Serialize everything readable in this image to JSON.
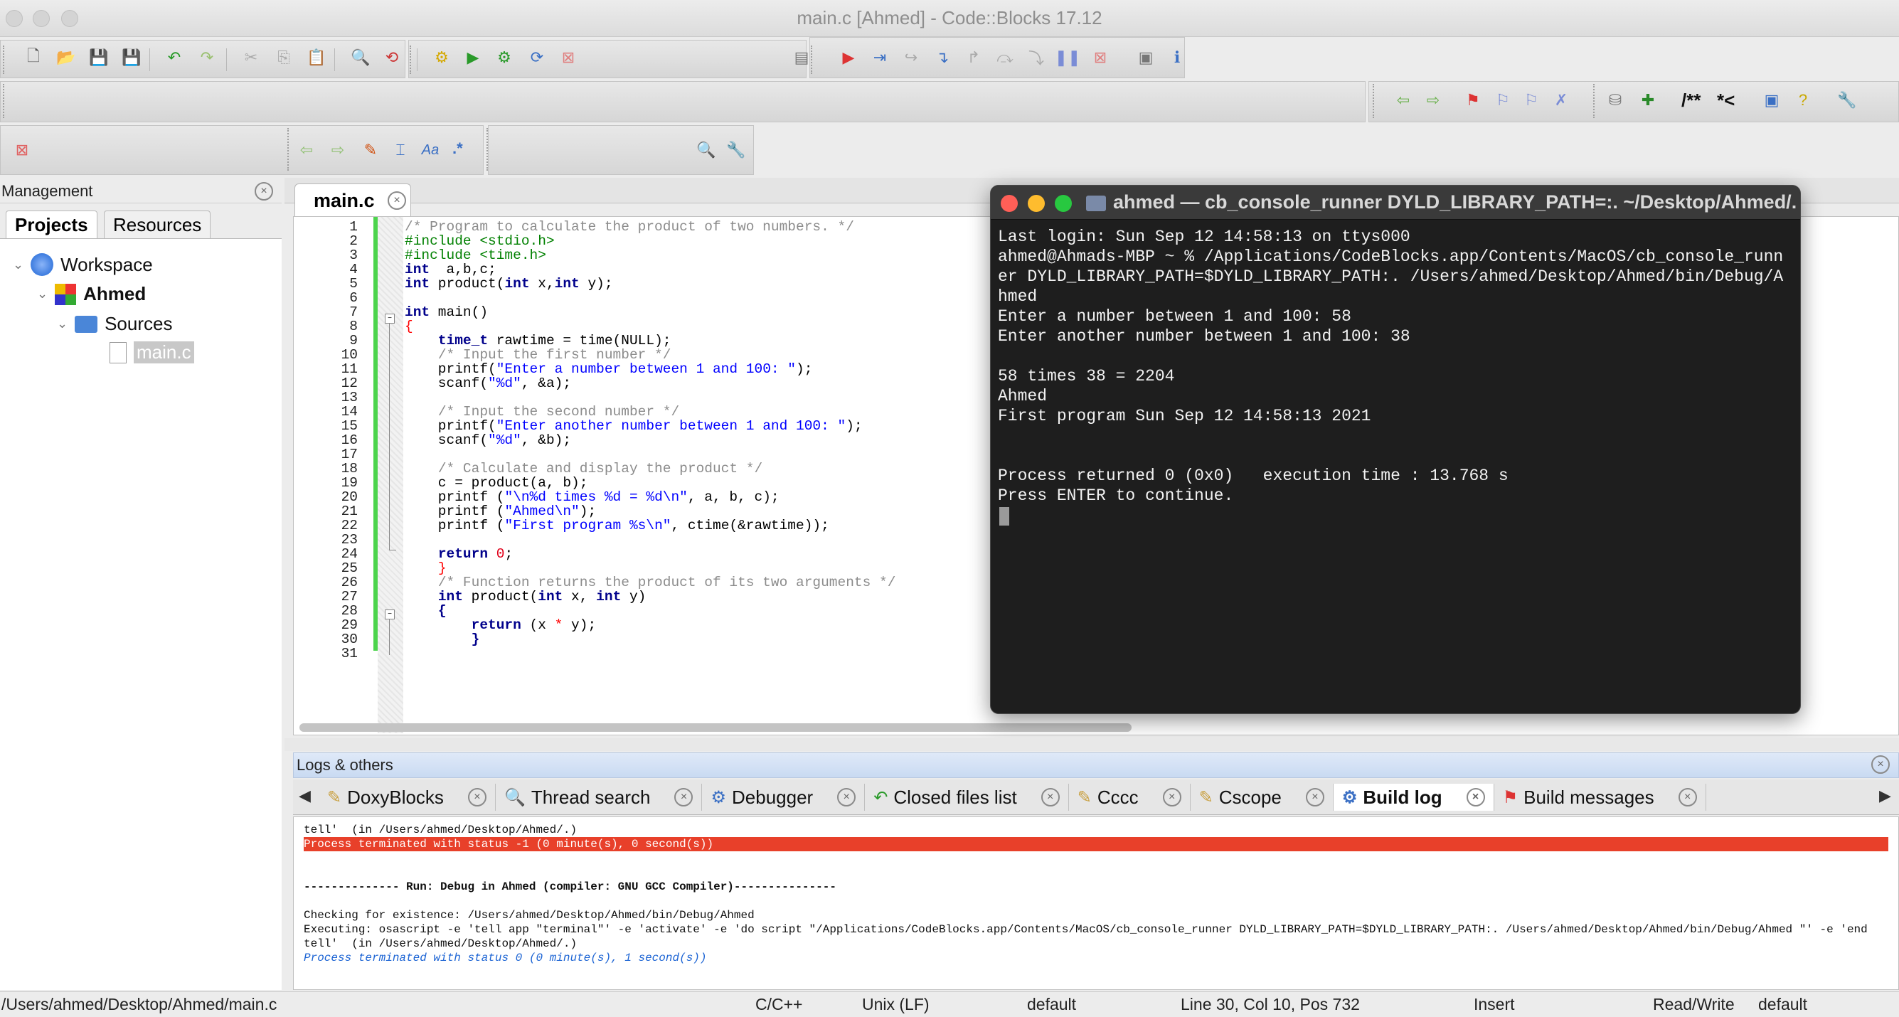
{
  "window": {
    "title": "main.c [Ahmed] - Code::Blocks 17.12"
  },
  "toolbar": {
    "icons": [
      "new-file-icon",
      "open-icon",
      "save-icon",
      "save-all-icon",
      "undo-icon",
      "redo-icon",
      "cut-icon",
      "copy-icon",
      "paste-icon",
      "find-icon",
      "replace-icon",
      "build-icon",
      "run-icon",
      "build-run-icon",
      "rebuild-icon",
      "abort-icon",
      "build-target-icon",
      "debug-icon",
      "run-to-cursor-icon",
      "next-line-icon",
      "step-into-icon",
      "step-out-icon",
      "next-instruction-icon",
      "step-into-instruction-icon",
      "break-debugger-icon",
      "stop-debugger-icon",
      "debug-windows-icon",
      "info-icon"
    ],
    "doc_tokens": {
      "doxy_block": "/**",
      "doxy_line": "*<"
    },
    "regex_label": ".*"
  },
  "management": {
    "title": "Management",
    "tabs": [
      "Projects",
      "Resources"
    ],
    "tree": {
      "workspace": "Workspace",
      "project": "Ahmed",
      "folder": "Sources",
      "file": "main.c"
    }
  },
  "editor": {
    "tab": "main.c",
    "lines": [
      [
        [
          "cm",
          "/* Program to calculate the product of two numbers. */"
        ]
      ],
      [
        [
          "pp",
          "#include <stdio.h>"
        ]
      ],
      [
        [
          "pp",
          "#include <time.h>"
        ]
      ],
      [
        [
          "kw",
          "int"
        ],
        [
          "",
          "  a,b,c;"
        ]
      ],
      [
        [
          "kw",
          "int"
        ],
        [
          "",
          " product("
        ],
        [
          "kw",
          "int"
        ],
        [
          "",
          " x,"
        ],
        [
          "kw",
          "int"
        ],
        [
          "",
          " y);"
        ]
      ],
      [
        [
          "",
          ""
        ]
      ],
      [
        [
          "kw",
          "int"
        ],
        [
          "",
          " main()"
        ]
      ],
      [
        [
          "op",
          "{"
        ]
      ],
      [
        [
          "",
          "    "
        ],
        [
          "kw",
          "time_t"
        ],
        [
          "",
          " rawtime = time(NULL);"
        ]
      ],
      [
        [
          "",
          "    "
        ],
        [
          "cm",
          "/* Input the first number */"
        ]
      ],
      [
        [
          "",
          "    printf("
        ],
        [
          "st",
          "\"Enter a number between 1 and 100: \""
        ],
        [
          "",
          ");"
        ]
      ],
      [
        [
          "",
          "    scanf("
        ],
        [
          "st",
          "\"%d\""
        ],
        [
          "",
          ", &a);"
        ]
      ],
      [
        [
          "",
          ""
        ]
      ],
      [
        [
          "",
          "    "
        ],
        [
          "cm",
          "/* Input the second number */"
        ]
      ],
      [
        [
          "",
          "    printf("
        ],
        [
          "st",
          "\"Enter another number between 1 and 100: \""
        ],
        [
          "",
          ");"
        ]
      ],
      [
        [
          "",
          "    scanf("
        ],
        [
          "st",
          "\"%d\""
        ],
        [
          "",
          ", &b);"
        ]
      ],
      [
        [
          "",
          ""
        ]
      ],
      [
        [
          "",
          "    "
        ],
        [
          "cm",
          "/* Calculate and display the product */"
        ]
      ],
      [
        [
          "",
          "    c = product(a, b);"
        ]
      ],
      [
        [
          "",
          "    printf ("
        ],
        [
          "st",
          "\"\\n%d times %d = %d\\n\""
        ],
        [
          "",
          ", a, b, c);"
        ]
      ],
      [
        [
          "",
          "    printf ("
        ],
        [
          "st",
          "\"Ahmed\\n\""
        ],
        [
          "",
          ");"
        ]
      ],
      [
        [
          "",
          "    printf ("
        ],
        [
          "st",
          "\"First program %s\\n\""
        ],
        [
          "",
          ", ctime(&rawtime));"
        ]
      ],
      [
        [
          "",
          ""
        ]
      ],
      [
        [
          "",
          "    "
        ],
        [
          "kw",
          "return"
        ],
        [
          "",
          " "
        ],
        [
          "nm",
          "0"
        ],
        [
          "",
          ";"
        ]
      ],
      [
        [
          "",
          "    "
        ],
        [
          "op",
          "}"
        ]
      ],
      [
        [
          "",
          "    "
        ],
        [
          "cm",
          "/* Function returns the product of its two arguments */"
        ]
      ],
      [
        [
          "",
          "    "
        ],
        [
          "kw",
          "int"
        ],
        [
          "",
          " product("
        ],
        [
          "kw",
          "int"
        ],
        [
          "",
          " x, "
        ],
        [
          "kw",
          "int"
        ],
        [
          "",
          " y)"
        ]
      ],
      [
        [
          "",
          "    "
        ],
        [
          "kw",
          "{"
        ]
      ],
      [
        [
          "",
          "        "
        ],
        [
          "kw",
          "return"
        ],
        [
          "",
          " (x "
        ],
        [
          "op",
          "*"
        ],
        [
          "",
          " y);"
        ]
      ],
      [
        [
          "",
          "        "
        ],
        [
          "kw",
          "}"
        ]
      ],
      [
        [
          "",
          ""
        ]
      ]
    ]
  },
  "terminal": {
    "title": "ahmed — cb_console_runner DYLD_LIBRARY_PATH=:. ~/Desktop/Ahmed/...",
    "lines": [
      "Last login: Sun Sep 12 14:58:13 on ttys000",
      "ahmed@Ahmads-MBP ~ % /Applications/CodeBlocks.app/Contents/MacOS/cb_console_runn",
      "er DYLD_LIBRARY_PATH=$DYLD_LIBRARY_PATH:. /Users/ahmed/Desktop/Ahmed/bin/Debug/A",
      "hmed",
      "Enter a number between 1 and 100: 58",
      "Enter another number between 1 and 100: 38",
      "",
      "58 times 38 = 2204",
      "Ahmed",
      "First program Sun Sep 12 14:58:13 2021",
      "",
      "",
      "Process returned 0 (0x0)   execution time : 13.768 s",
      "Press ENTER to continue."
    ]
  },
  "logs": {
    "title": "Logs & others",
    "tabs": [
      {
        "label": "DoxyBlocks",
        "icon": "doxyblocks-icon"
      },
      {
        "label": "Thread search",
        "icon": "thread-search-icon"
      },
      {
        "label": "Debugger",
        "icon": "debugger-icon"
      },
      {
        "label": "Closed files list",
        "icon": "closed-files-icon"
      },
      {
        "label": "Cccc",
        "icon": "cccc-icon"
      },
      {
        "label": "Cscope",
        "icon": "cscope-icon"
      },
      {
        "label": "Build log",
        "icon": "build-log-icon",
        "active": true
      },
      {
        "label": "Build messages",
        "icon": "build-messages-icon"
      }
    ],
    "lines": [
      "tell'  (in /Users/ahmed/Desktop/Ahmed/.)",
      "Process terminated with status -1 (0 minute(s), 0 second(s))",
      "",
      "",
      "-------------- Run: Debug in Ahmed (compiler: GNU GCC Compiler)---------------",
      "",
      "Checking for existence: /Users/ahmed/Desktop/Ahmed/bin/Debug/Ahmed",
      "Executing: osascript -e 'tell app \"terminal\"' -e 'activate' -e 'do script \"/Applications/CodeBlocks.app/Contents/MacOS/cb_console_runner DYLD_LIBRARY_PATH=$DYLD_LIBRARY_PATH:. /Users/ahmed/Desktop/Ahmed/bin/Debug/Ahmed \"' -e 'end",
      "tell'  (in /Users/ahmed/Desktop/Ahmed/.)",
      "Process terminated with status 0 (0 minute(s), 1 second(s))"
    ]
  },
  "status": {
    "path": "/Users/ahmed/Desktop/Ahmed/main.c",
    "lang": "C/C++",
    "eol": "Unix (LF)",
    "encoding": "default",
    "position": "Line 30, Col 10, Pos 732",
    "mode": "Insert",
    "access": "Read/Write",
    "profile": "default"
  },
  "colors": {
    "error_bg": "#e8402a",
    "accent": "#1c64d4",
    "terminal_bg": "#1e1e1e"
  }
}
